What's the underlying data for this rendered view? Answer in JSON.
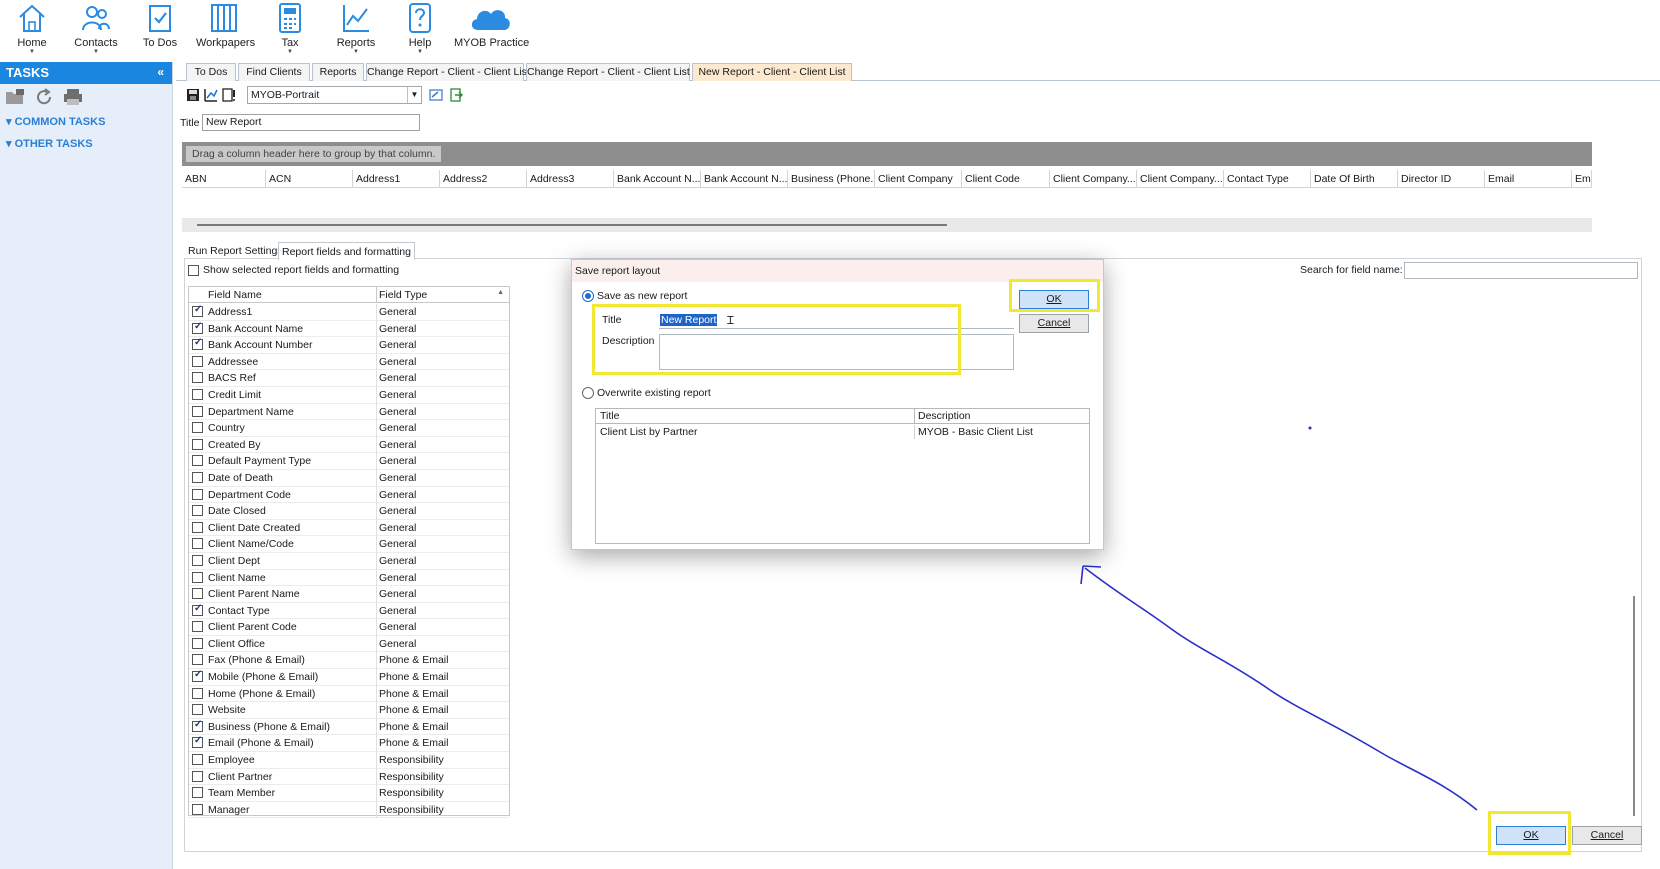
{
  "ribbon": {
    "items": [
      {
        "label": "Home",
        "icon": "home-icon",
        "dropdown": true
      },
      {
        "label": "Contacts",
        "icon": "contacts-icon",
        "dropdown": true
      },
      {
        "label": "To Dos",
        "icon": "todos-icon",
        "dropdown": false
      },
      {
        "label": "Workpapers",
        "icon": "workpapers-icon",
        "dropdown": false
      },
      {
        "label": "Tax",
        "icon": "tax-calculator-icon",
        "dropdown": true
      },
      {
        "label": "Reports",
        "icon": "reports-chart-icon",
        "dropdown": true
      },
      {
        "label": "Help",
        "icon": "help-icon",
        "dropdown": true
      },
      {
        "label": "MYOB Practice",
        "icon": "cloud-icon",
        "dropdown": false
      }
    ],
    "dropdown_glyph": "▼"
  },
  "sidebar": {
    "header": "TASKS",
    "collapse_glyph": "«",
    "sections": [
      "▾ COMMON TASKS",
      "▾ OTHER TASKS"
    ]
  },
  "doc_tabs": [
    {
      "label": "To Dos",
      "active": false
    },
    {
      "label": "Find Clients",
      "active": false
    },
    {
      "label": "Reports",
      "active": false
    },
    {
      "label": "Change Report - Client - Client List",
      "active": false
    },
    {
      "label": "Change Report - Client - Client List",
      "active": false
    },
    {
      "label": "New Report - Client - Client List",
      "active": true
    }
  ],
  "toolbar": {
    "layout_value": "MYOB-Portrait"
  },
  "report": {
    "title_label": "Title",
    "title_value": "New Report"
  },
  "grid": {
    "group_hint": "Drag a column header here to group by that column.",
    "columns": [
      "ABN",
      "ACN",
      "Address1",
      "Address2",
      "Address3",
      "Bank Account N...",
      "Bank Account N...",
      "Business (Phone...",
      "Client Company",
      "Client Code",
      "Client Company...",
      "Client Company...",
      "Contact Type",
      "Date Of Birth",
      "Director ID",
      "Email",
      "Em"
    ]
  },
  "lower": {
    "tabs": [
      {
        "label": "Run Report Settings",
        "active": false
      },
      {
        "label": "Report fields and formatting",
        "active": true
      }
    ],
    "show_selected_label": "Show selected report fields and formatting",
    "search_label": "Search for field name:",
    "field_list": {
      "headers": [
        "Field Name",
        "Field Type"
      ],
      "rows": [
        {
          "name": "Address1",
          "type": "General",
          "checked": true
        },
        {
          "name": "Bank Account Name",
          "type": "General",
          "checked": true
        },
        {
          "name": "Bank Account Number",
          "type": "General",
          "checked": true
        },
        {
          "name": "Addressee",
          "type": "General",
          "checked": false
        },
        {
          "name": "BACS Ref",
          "type": "General",
          "checked": false
        },
        {
          "name": "Credit Limit",
          "type": "General",
          "checked": false
        },
        {
          "name": "Department Name",
          "type": "General",
          "checked": false
        },
        {
          "name": "Country",
          "type": "General",
          "checked": false
        },
        {
          "name": "Created By",
          "type": "General",
          "checked": false
        },
        {
          "name": "Default Payment Type",
          "type": "General",
          "checked": false
        },
        {
          "name": "Date of Death",
          "type": "General",
          "checked": false
        },
        {
          "name": "Department Code",
          "type": "General",
          "checked": false
        },
        {
          "name": "Date Closed",
          "type": "General",
          "checked": false
        },
        {
          "name": "Client Date Created",
          "type": "General",
          "checked": false
        },
        {
          "name": "Client Name/Code",
          "type": "General",
          "checked": false
        },
        {
          "name": "Client Dept",
          "type": "General",
          "checked": false
        },
        {
          "name": "Client Name",
          "type": "General",
          "checked": false
        },
        {
          "name": "Client Parent Name",
          "type": "General",
          "checked": false
        },
        {
          "name": "Contact Type",
          "type": "General",
          "checked": true
        },
        {
          "name": "Client Parent Code",
          "type": "General",
          "checked": false
        },
        {
          "name": "Client Office",
          "type": "General",
          "checked": false
        },
        {
          "name": "Fax (Phone & Email)",
          "type": "Phone & Email",
          "checked": false
        },
        {
          "name": "Mobile (Phone & Email)",
          "type": "Phone & Email",
          "checked": true
        },
        {
          "name": "Home (Phone & Email)",
          "type": "Phone & Email",
          "checked": false
        },
        {
          "name": "Website",
          "type": "Phone & Email",
          "checked": false
        },
        {
          "name": "Business (Phone & Email)",
          "type": "Phone & Email",
          "checked": true
        },
        {
          "name": "Email (Phone & Email)",
          "type": "Phone & Email",
          "checked": true
        },
        {
          "name": "Employee",
          "type": "Responsibility",
          "checked": false
        },
        {
          "name": "Client Partner",
          "type": "Responsibility",
          "checked": false
        },
        {
          "name": "Team Member",
          "type": "Responsibility",
          "checked": false
        },
        {
          "name": "Manager",
          "type": "Responsibility",
          "checked": false
        }
      ]
    },
    "ok_label": "OK",
    "cancel_label": "Cancel"
  },
  "dialog": {
    "title": "Save report layout",
    "save_new_label": "Save as new report",
    "title_field_label": "Title",
    "title_value": "New Report",
    "description_label": "Description",
    "overwrite_label": "Overwrite existing report",
    "ok_label": "OK",
    "cancel_label": "Cancel",
    "table_headers": [
      "Title",
      "Description"
    ],
    "table_rows": [
      {
        "title": "Client List by Partner",
        "description": "MYOB - Basic Client List"
      }
    ]
  },
  "colors": {
    "accent_blue": "#1b86e0",
    "highlight_yellow": "#f2e733",
    "annotation_blue": "#2a2fc8",
    "active_tab": "#fde9cf"
  }
}
